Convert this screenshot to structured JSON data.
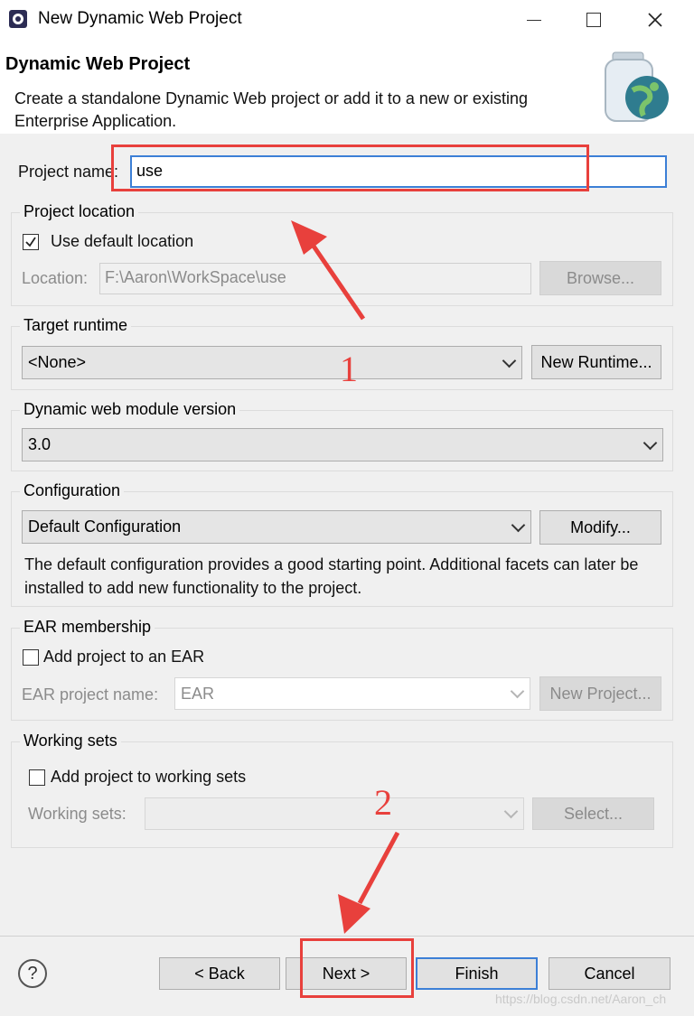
{
  "window": {
    "title": "New Dynamic Web Project"
  },
  "banner": {
    "title": "Dynamic Web Project",
    "description": "Create a standalone Dynamic Web project or add it to a new or existing Enterprise Application."
  },
  "project_name": {
    "label": "Project name:",
    "value": "use"
  },
  "project_location": {
    "title": "Project location",
    "use_default_label": "Use default location",
    "use_default_checked": true,
    "location_label": "Location:",
    "location_value": "F:\\Aaron\\WorkSpace\\use",
    "browse_label": "Browse..."
  },
  "target_runtime": {
    "title": "Target runtime",
    "selected": "<None>",
    "new_runtime_label": "New Runtime..."
  },
  "module_version": {
    "title": "Dynamic web module version",
    "selected": "3.0"
  },
  "configuration": {
    "title": "Configuration",
    "selected": "Default Configuration",
    "modify_label": "Modify...",
    "description": "The default configuration provides a good starting point. Additional facets can later be installed to add new functionality to the project."
  },
  "ear": {
    "title": "EAR membership",
    "add_label": "Add project to an EAR",
    "checked": false,
    "project_name_label": "EAR project name:",
    "project_name_value": "EAR",
    "new_project_label": "New Project..."
  },
  "working_sets": {
    "title": "Working sets",
    "add_label": "Add project to working sets",
    "checked": false,
    "label": "Working sets:",
    "select_label": "Select..."
  },
  "footer": {
    "help_icon": "question-mark-icon",
    "back_label": "< Back",
    "next_label": "Next >",
    "finish_label": "Finish",
    "cancel_label": "Cancel"
  },
  "annotations": {
    "step1": "1",
    "step2": "2"
  },
  "watermark": "https://blog.csdn.net/Aaron_ch",
  "colors": {
    "annotation": "#e8403c",
    "focus": "#3c7fd6"
  }
}
